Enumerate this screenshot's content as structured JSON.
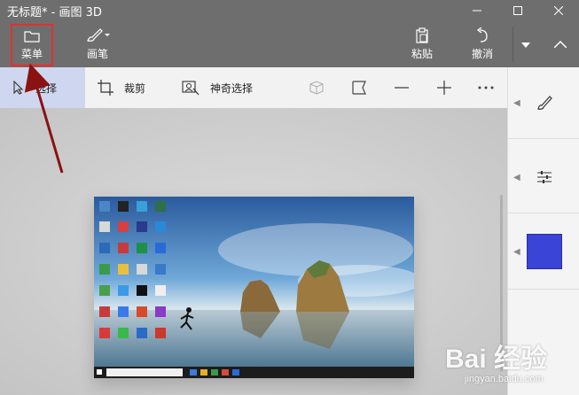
{
  "window": {
    "title": "无标题* - 画图 3D",
    "controls": [
      "minimize",
      "maximize",
      "close"
    ]
  },
  "ribbon": {
    "menu_label": "菜单",
    "brush_label": "画笔",
    "paste_label": "粘贴",
    "undo_label": "撤消"
  },
  "toolbar": {
    "select_label": "选择",
    "crop_label": "裁剪",
    "magic_select_label": "神奇选择",
    "icon_tools": [
      "3d-view-icon",
      "flag-icon",
      "zoom-out-icon",
      "zoom-in-icon",
      "more-icon"
    ]
  },
  "side_panel": {
    "items": [
      "brush-icon",
      "adjust-icon",
      "color-swatch"
    ],
    "selected_color": "#3a44d6"
  },
  "watermark": {
    "text": "Bai 经验",
    "sub": "jingyan.baidu.com"
  },
  "colors": {
    "ribbon_bg": "#6e6e6e",
    "toolbar_bg": "#f2f2f2",
    "selected_tool_bg": "#cfd6ef",
    "highlight_box": "#e03030",
    "arrow": "#8a1212"
  }
}
